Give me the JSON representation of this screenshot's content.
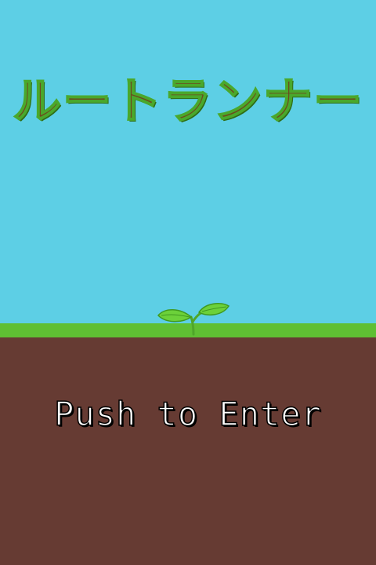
{
  "game": {
    "title": "ルートランナー",
    "prompt": "Push to Enter"
  },
  "colors": {
    "sky": "#5dcfe5",
    "grass": "#5fbf33",
    "soil": "#663b33",
    "title_fill": "#6b4a1e",
    "title_outline": "#4aa82c",
    "leaf": "#6cd13a"
  },
  "icons": {
    "sprout": "sprout-icon"
  }
}
